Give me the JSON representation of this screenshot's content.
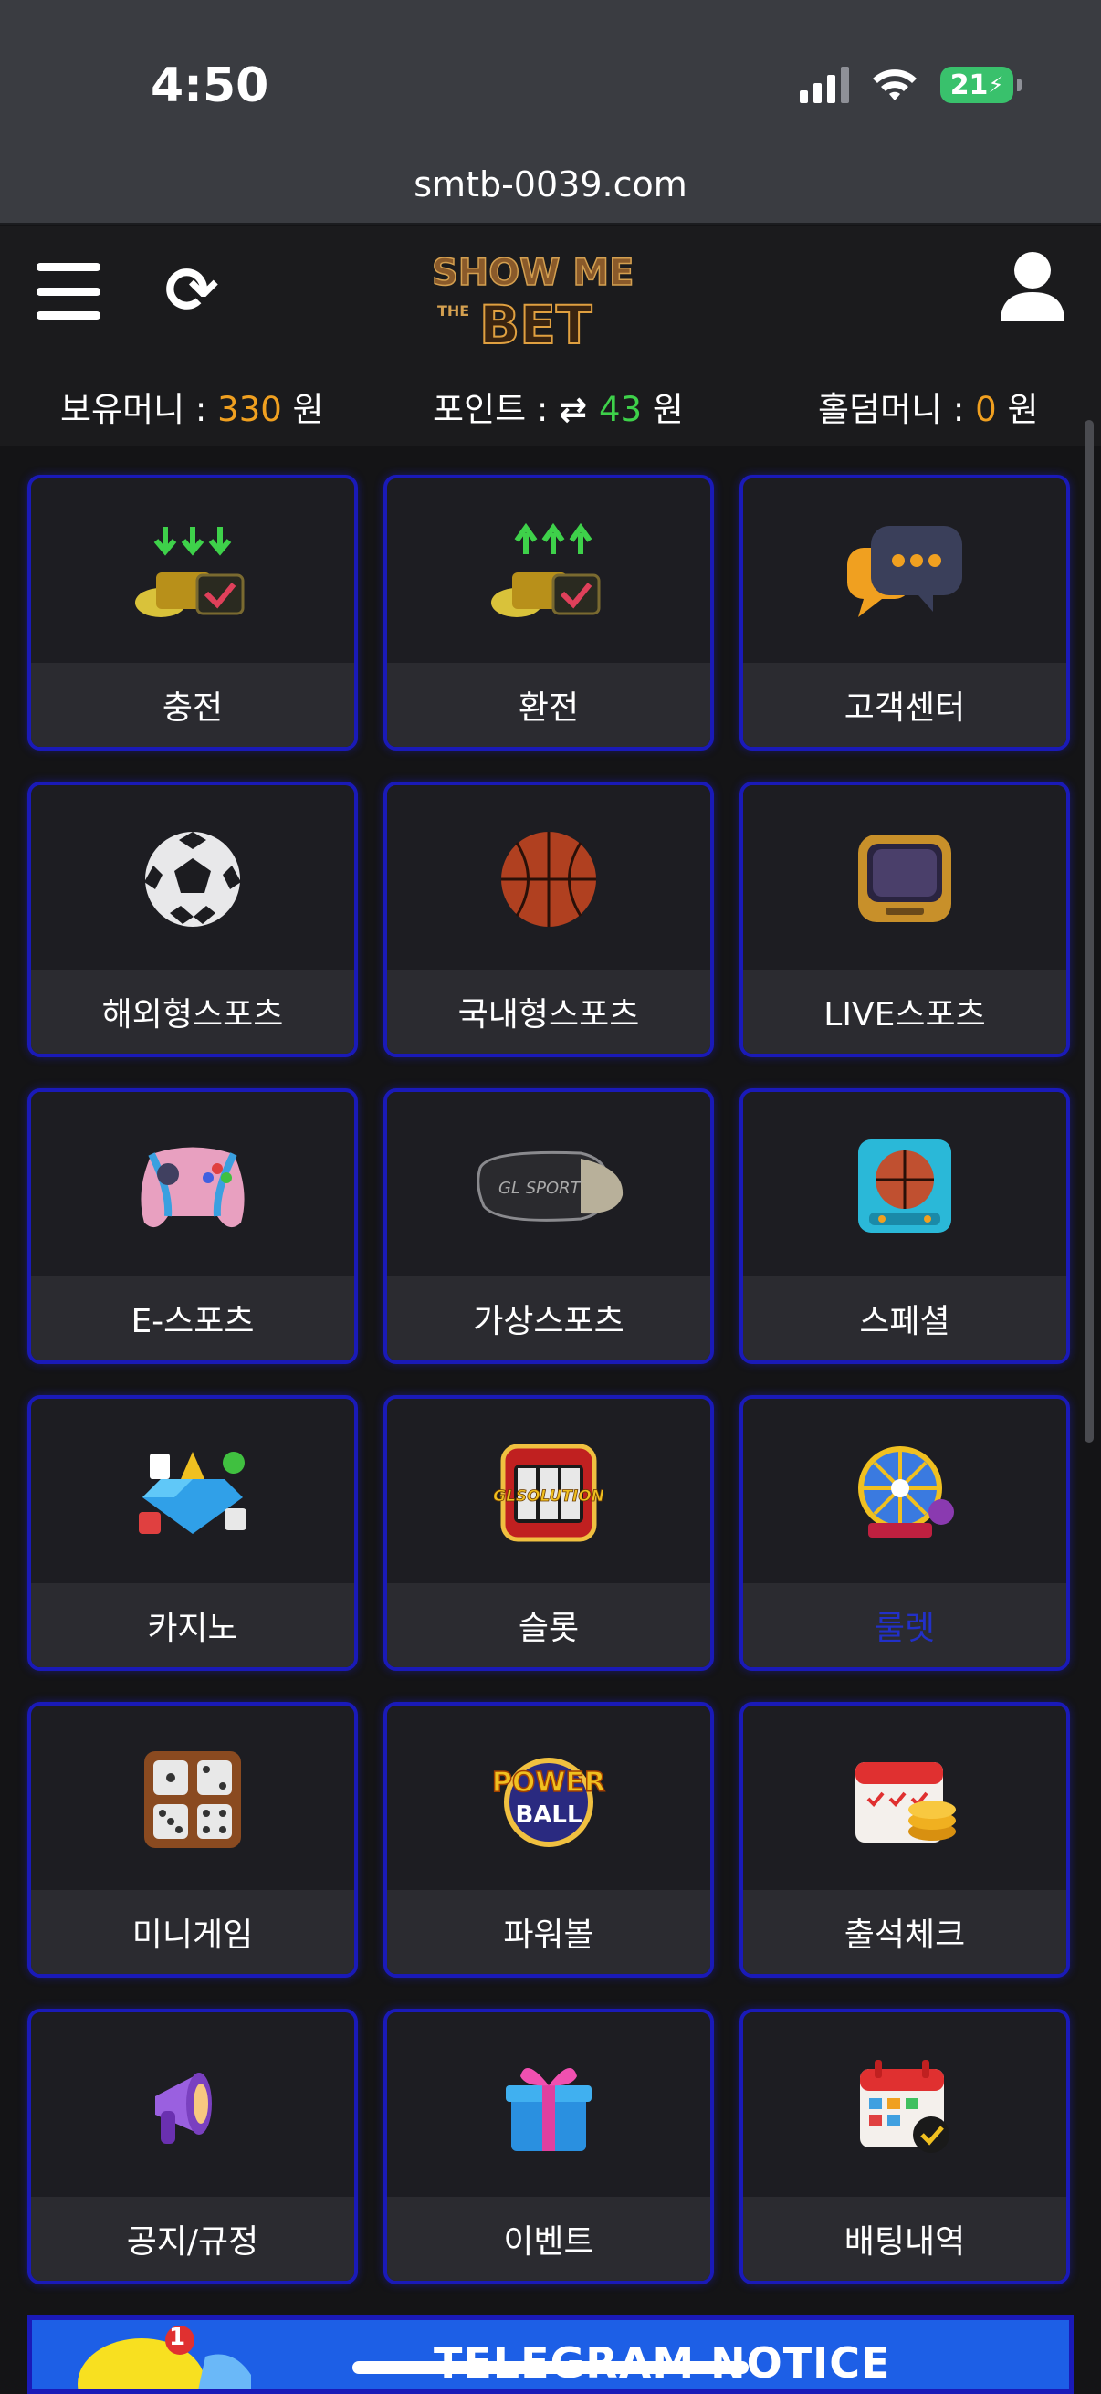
{
  "status": {
    "time": "4:50",
    "battery": "21"
  },
  "browser": {
    "url": "smtb-0039.com"
  },
  "header": {
    "logo_alt": "SHOW ME THE BET",
    "balances": {
      "money_label": "보유머니 : ",
      "money_value": "330",
      "money_unit": " 원",
      "point_label": "포인트 : ",
      "point_value": "43",
      "point_unit": " 원",
      "holdem_label": "홀덤머니 : ",
      "holdem_value": "0",
      "holdem_unit": " 원"
    }
  },
  "menu": [
    {
      "label": "충전",
      "icon": "coin-deposit-icon"
    },
    {
      "label": "환전",
      "icon": "coin-withdraw-icon"
    },
    {
      "label": "고객센터",
      "icon": "chat-bubble-icon"
    },
    {
      "label": "해외형스포츠",
      "icon": "soccer-ball-icon"
    },
    {
      "label": "국내형스포츠",
      "icon": "basketball-icon"
    },
    {
      "label": "LIVE스포츠",
      "icon": "tv-icon"
    },
    {
      "label": "E-스포츠",
      "icon": "gamepad-icon"
    },
    {
      "label": "가상스포츠",
      "icon": "vr-headset-icon"
    },
    {
      "label": "스페셜",
      "icon": "arcade-basketball-icon"
    },
    {
      "label": "카지노",
      "icon": "casino-gem-icon"
    },
    {
      "label": "슬롯",
      "icon": "slot-machine-icon"
    },
    {
      "label": "룰렛",
      "icon": "roulette-wheel-icon"
    },
    {
      "label": "미니게임",
      "icon": "dice-board-icon"
    },
    {
      "label": "파워볼",
      "icon": "powerball-icon"
    },
    {
      "label": "출석체크",
      "icon": "calendar-coins-icon"
    },
    {
      "label": "공지/규정",
      "icon": "megaphone-icon"
    },
    {
      "label": "이벤트",
      "icon": "gift-box-icon"
    },
    {
      "label": "배팅내역",
      "icon": "calendar-check-icon"
    }
  ],
  "colors": {
    "tile_border": "#1a1ab8",
    "accent_orange": "#f0a020",
    "accent_green": "#3ed14a"
  },
  "banner": {
    "text": "TELEGRAM NOTICE CHANNEL",
    "badge": "1"
  }
}
